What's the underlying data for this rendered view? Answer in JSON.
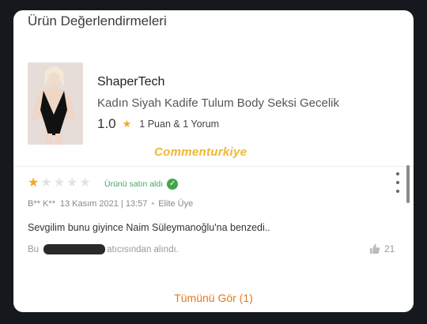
{
  "section": {
    "title": "Ürün Değerlendirmeleri"
  },
  "product": {
    "brand": "ShaperTech",
    "name": "Kadın Siyah Kadife Tulum Body Seksi Gecelik",
    "score": "1.0",
    "rating_summary": "1 Puan & 1 Yorum"
  },
  "watermark": "Commenturkiye",
  "review": {
    "rating": 1,
    "max_rating": 5,
    "purchased_label": "Ürünü satın aldı",
    "author": "B** K**",
    "date": "13 Kasım 2021 | 13:57",
    "badge": "Elite Üye",
    "text": "Sevgilim bunu giyince Naim Süleymanoğlu'na benzedi..",
    "seller_prefix": "Bu",
    "seller_suffix": "atıcısından alındı.",
    "likes": "21"
  },
  "footer": {
    "see_all": "Tümünü Gör (1)"
  },
  "colors": {
    "star": "#f5a623",
    "verified": "#3fa64c",
    "accent": "#e07a1f",
    "watermark": "#f0b732"
  },
  "icons": [
    "star-icon",
    "check-circle-icon",
    "more-vertical-icon",
    "thumbs-up-icon"
  ]
}
